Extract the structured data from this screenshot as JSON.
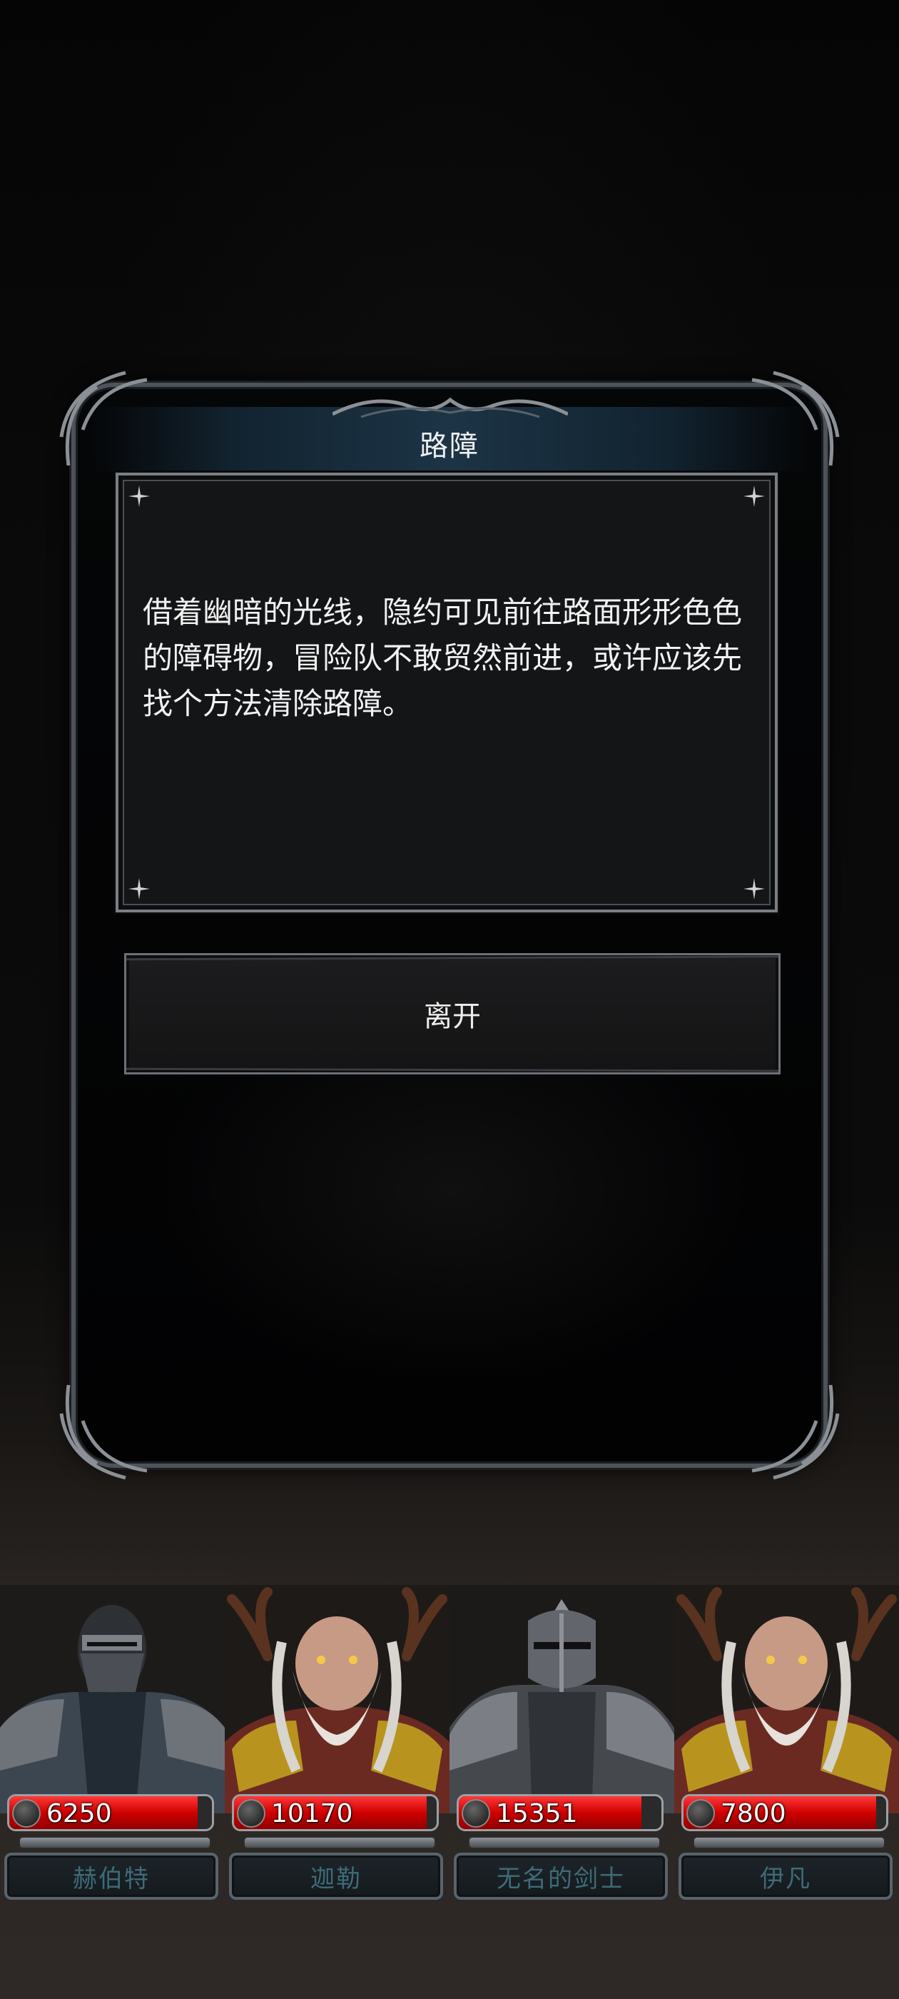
{
  "dialog": {
    "title": "路障",
    "body": "借着幽暗的光线，隐约可见前往路面形形色色的障碍物，冒险队不敢贸然前进，或许应该先找个方法清除路障。",
    "leave_label": "离开"
  },
  "party": [
    {
      "name": "赫伯特",
      "hp": "6250",
      "hp_fraction": 0.93
    },
    {
      "name": "迦勒",
      "hp": "10170",
      "hp_fraction": 0.95
    },
    {
      "name": "无名的剑士",
      "hp": "15351",
      "hp_fraction": 0.9
    },
    {
      "name": "伊凡",
      "hp": "7800",
      "hp_fraction": 0.95
    }
  ],
  "colors": {
    "hp_red": "#d00000",
    "name_text": "#3e6b78",
    "panel_border": "#7a7f85"
  }
}
